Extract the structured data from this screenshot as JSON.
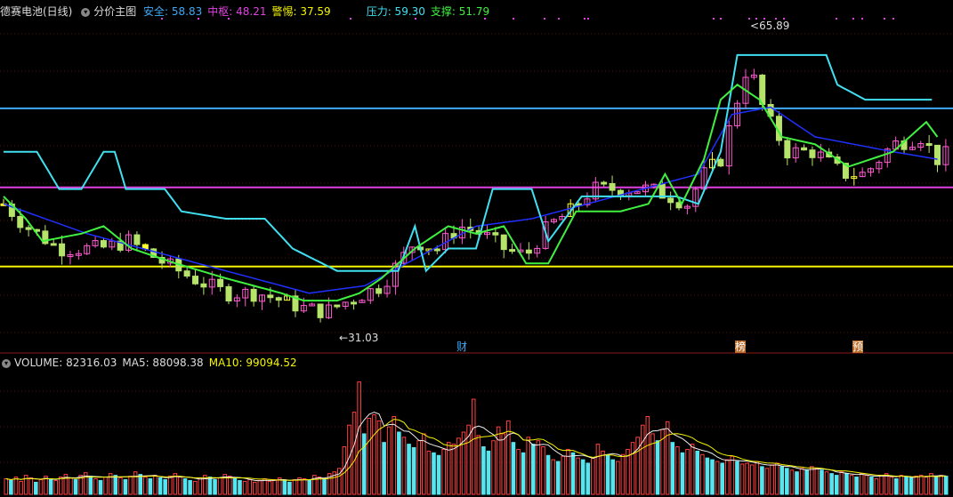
{
  "main_header": {
    "stock": "德赛电池(日线)",
    "indicator": "分价主图",
    "items": [
      {
        "label": "安全: ",
        "value": "58.83",
        "color": "#3fa9f5"
      },
      {
        "label": "中枢: ",
        "value": "48.21",
        "color": "#e040e0"
      },
      {
        "label": "警惕: ",
        "value": "37.59",
        "color": "#f5f500"
      },
      {
        "label": "压力: ",
        "value": "59.30",
        "color": "#40e0f0"
      },
      {
        "label": "支撑: ",
        "value": "51.79",
        "color": "#40f040"
      }
    ]
  },
  "volume_header": {
    "items": [
      {
        "label": "VOLUME: ",
        "value": "82316.03",
        "color": "#dddddd"
      },
      {
        "label": "MA5: ",
        "value": "88098.38",
        "color": "#dddddd"
      },
      {
        "label": "MA10: ",
        "value": "99094.52",
        "color": "#f5f500"
      }
    ]
  },
  "annotations": {
    "high_label": "65.89",
    "low_label": "31.03",
    "event_markers": [
      "财",
      "榜",
      "预"
    ]
  },
  "chart_data": [
    {
      "type": "candlestick",
      "title": "分价主图",
      "ylim": [
        28,
        71
      ],
      "horizontal_lines": [
        {
          "name": "安全",
          "value": 58.83,
          "color": "#3fa9f5"
        },
        {
          "name": "中枢",
          "value": 48.21,
          "color": "#e040e0"
        },
        {
          "name": "警惕",
          "value": 37.59,
          "color": "#f5f500"
        }
      ],
      "high": 65.89,
      "low": 31.03,
      "price_path": [
        [
          0,
          46
        ],
        [
          8,
          43
        ],
        [
          20,
          40
        ],
        [
          35,
          40
        ],
        [
          45,
          41
        ],
        [
          58,
          38
        ],
        [
          68,
          36
        ],
        [
          80,
          34
        ],
        [
          92,
          34
        ],
        [
          100,
          33
        ],
        [
          108,
          32
        ],
        [
          116,
          31.5
        ],
        [
          124,
          33
        ],
        [
          136,
          35
        ],
        [
          148,
          41
        ],
        [
          156,
          40
        ],
        [
          164,
          43
        ],
        [
          172,
          42
        ],
        [
          180,
          40
        ],
        [
          188,
          39
        ],
        [
          196,
          43
        ],
        [
          204,
          45
        ],
        [
          212,
          48
        ],
        [
          222,
          48
        ],
        [
          232,
          48
        ],
        [
          240,
          47
        ],
        [
          246,
          46
        ],
        [
          252,
          50
        ],
        [
          258,
          52
        ],
        [
          264,
          60
        ],
        [
          268,
          65
        ],
        [
          274,
          58
        ],
        [
          282,
          53
        ],
        [
          292,
          53
        ],
        [
          302,
          50
        ],
        [
          310,
          50
        ],
        [
          320,
          54
        ],
        [
          330,
          55
        ],
        [
          336,
          52
        ],
        [
          346,
          54
        ],
        [
          352,
          50
        ],
        [
          356,
          48
        ]
      ],
      "resistance_path": [
        [
          0,
          53
        ],
        [
          12,
          53
        ],
        [
          20,
          48
        ],
        [
          28,
          48
        ],
        [
          36,
          53
        ],
        [
          40,
          53
        ],
        [
          44,
          48
        ],
        [
          58,
          48
        ],
        [
          64,
          45
        ],
        [
          80,
          44
        ],
        [
          94,
          44
        ],
        [
          104,
          40
        ],
        [
          120,
          37
        ],
        [
          132,
          37
        ],
        [
          142,
          37
        ],
        [
          148,
          43
        ],
        [
          152,
          37
        ],
        [
          160,
          40
        ],
        [
          170,
          40
        ],
        [
          176,
          48
        ],
        [
          190,
          48
        ],
        [
          196,
          41
        ],
        [
          208,
          47
        ],
        [
          236,
          47
        ],
        [
          242,
          47
        ],
        [
          250,
          46
        ],
        [
          258,
          53
        ],
        [
          264,
          66
        ],
        [
          276,
          66
        ],
        [
          296,
          66
        ],
        [
          300,
          62
        ],
        [
          310,
          60
        ],
        [
          326,
          60
        ],
        [
          334,
          60
        ]
      ],
      "support_path": [
        [
          0,
          47
        ],
        [
          8,
          44
        ],
        [
          14,
          41
        ],
        [
          28,
          42
        ],
        [
          36,
          43
        ],
        [
          46,
          40
        ],
        [
          62,
          38
        ],
        [
          80,
          36
        ],
        [
          100,
          34
        ],
        [
          108,
          33
        ],
        [
          120,
          33
        ],
        [
          128,
          34
        ],
        [
          136,
          36
        ],
        [
          148,
          40
        ],
        [
          160,
          43
        ],
        [
          170,
          42
        ],
        [
          180,
          43
        ],
        [
          188,
          38
        ],
        [
          196,
          38
        ],
        [
          206,
          45
        ],
        [
          222,
          45
        ],
        [
          232,
          46
        ],
        [
          238,
          50
        ],
        [
          244,
          46
        ],
        [
          252,
          52
        ],
        [
          258,
          60
        ],
        [
          264,
          62
        ],
        [
          272,
          60
        ],
        [
          280,
          55
        ],
        [
          292,
          54
        ],
        [
          304,
          51
        ],
        [
          320,
          53
        ],
        [
          332,
          57
        ],
        [
          336,
          55
        ]
      ],
      "bluestep_path": [
        [
          0,
          46
        ],
        [
          30,
          42
        ],
        [
          60,
          39
        ],
        [
          90,
          36
        ],
        [
          110,
          34
        ],
        [
          130,
          35
        ],
        [
          150,
          39
        ],
        [
          170,
          43
        ],
        [
          190,
          44
        ],
        [
          210,
          46
        ],
        [
          230,
          48
        ],
        [
          250,
          50
        ],
        [
          262,
          58
        ],
        [
          276,
          59
        ],
        [
          292,
          55
        ],
        [
          320,
          53
        ],
        [
          336,
          52
        ]
      ]
    },
    {
      "type": "bar",
      "title": "VOLUME",
      "series": [
        {
          "name": "VOLUME",
          "last": 82316.03
        },
        {
          "name": "MA5",
          "last": 88098.38
        },
        {
          "name": "MA10",
          "last": 99094.52
        }
      ],
      "ylim": [
        0,
        145000
      ],
      "volumes": [
        18,
        16,
        20,
        15,
        22,
        19,
        14,
        17,
        21,
        18,
        16,
        20,
        23,
        19,
        17,
        22,
        25,
        21,
        18,
        16,
        20,
        24,
        22,
        19,
        17,
        21,
        26,
        23,
        20,
        18,
        22,
        19,
        17,
        21,
        24,
        20,
        18,
        16,
        15,
        19,
        22,
        20,
        17,
        19,
        23,
        21,
        18,
        16,
        15,
        17,
        14,
        16,
        18,
        15,
        17,
        19,
        16,
        14,
        17,
        19,
        18,
        16,
        22,
        20,
        18,
        24,
        26,
        30,
        55,
        80,
        95,
        130,
        70,
        88,
        92,
        85,
        60,
        78,
        90,
        72,
        66,
        58,
        54,
        62,
        70,
        50,
        48,
        45,
        52,
        60,
        58,
        65,
        72,
        80,
        110,
        68,
        55,
        50,
        62,
        78,
        70,
        85,
        60,
        52,
        48,
        66,
        58,
        62,
        55,
        45,
        40,
        38,
        44,
        52,
        48,
        42,
        40,
        36,
        42,
        58,
        50,
        45,
        40,
        38,
        46,
        52,
        60,
        66,
        80,
        90,
        70,
        62,
        75,
        84,
        60,
        55,
        48,
        52,
        58,
        50,
        46,
        42,
        40,
        38,
        36,
        40,
        44,
        38,
        35,
        36,
        34,
        38,
        32,
        30,
        34,
        36,
        32,
        30,
        28,
        26,
        30,
        28,
        32,
        30,
        28,
        26,
        24,
        22,
        26,
        24,
        22,
        20,
        24,
        22,
        20,
        18,
        22,
        24,
        20,
        18,
        22,
        20,
        19,
        21,
        22,
        20,
        24,
        20,
        22,
        21
      ]
    }
  ]
}
